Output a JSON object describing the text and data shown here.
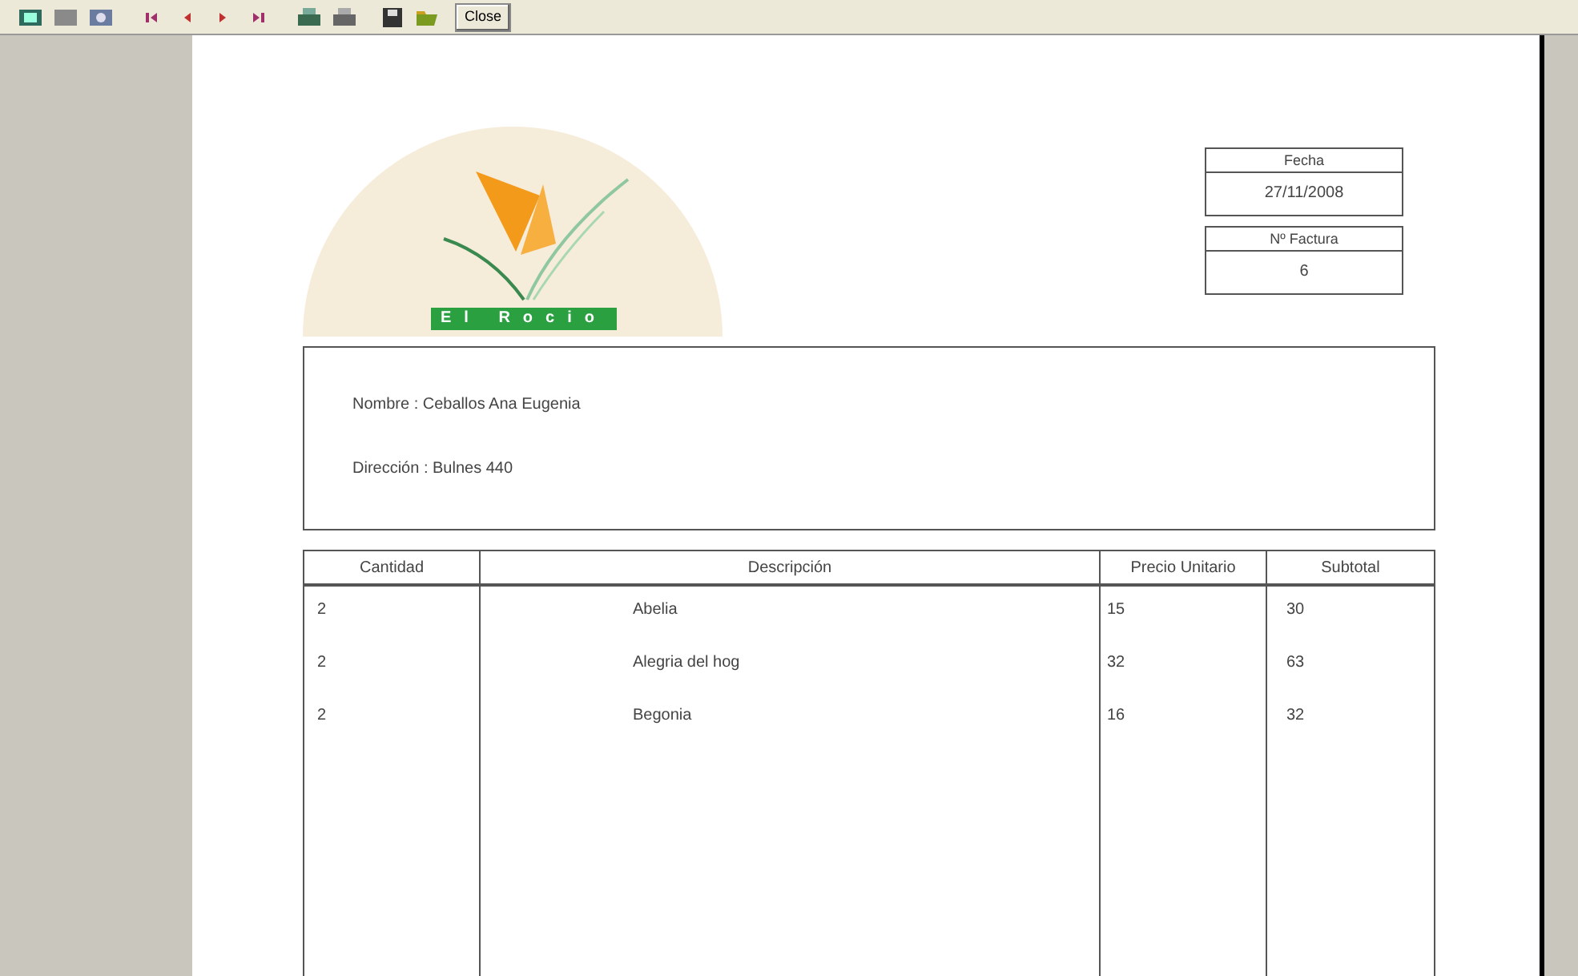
{
  "toolbar": {
    "close_label": "Close"
  },
  "logo": {
    "text": "El Rocio"
  },
  "fecha": {
    "label": "Fecha",
    "value": "27/11/2008"
  },
  "factura": {
    "label": "Nº Factura",
    "value": "6"
  },
  "customer": [
    "Nombre : Ceballos Ana Eugenia",
    "Dirección : Bulnes 440"
  ],
  "table": {
    "columns": [
      "Cantidad",
      "Descripción",
      "Precio Unitario",
      "Subtotal"
    ],
    "rows": [
      [
        "2",
        "Abelia",
        "15",
        "30"
      ],
      [
        "2",
        "Alegria del hog",
        "32",
        "63"
      ],
      [
        "2",
        "Begonia",
        "16",
        "32"
      ]
    ]
  }
}
